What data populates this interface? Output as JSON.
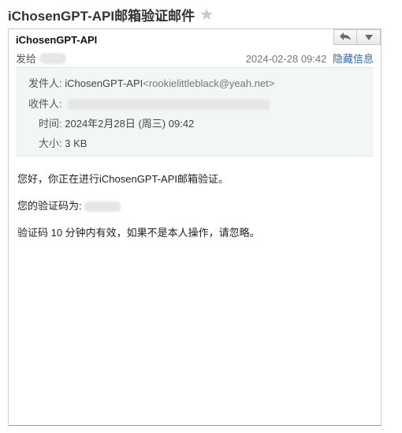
{
  "subject": "iChosenGPT-API邮箱验证邮件",
  "sender_name": "iChosenGPT-API",
  "to_label": "发给",
  "date_short": "2024-02-28 09:42",
  "hide_info_label": "隐藏信息",
  "details": {
    "from_label": "发件人:",
    "from_name": "iChosenGPT-API",
    "from_email": "<rookielittleblack@yeah.net>",
    "to_label": "收件人:",
    "time_label": "时间:",
    "time_value": "2024年2月28日 (周三) 09:42",
    "size_label": "大小:",
    "size_value": "3 KB"
  },
  "body": {
    "greeting": "您好，你正在进行iChosenGPT-API邮箱验证。",
    "code_label": "您的验证码为:",
    "validity": "验证码 10 分钟内有效，如果不是本人操作，请忽略。"
  },
  "icons": {
    "favorite": "star-icon",
    "reply": "reply-icon",
    "more": "dropdown-icon"
  }
}
